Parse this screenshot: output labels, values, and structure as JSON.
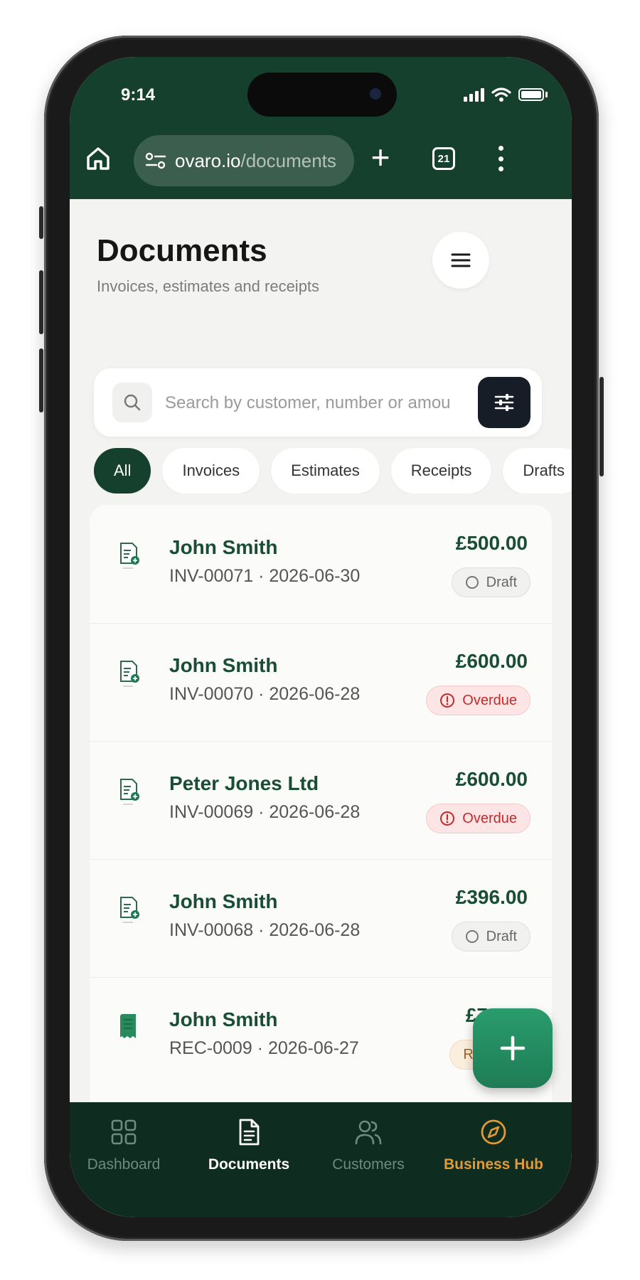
{
  "status_bar": {
    "time": "9:14"
  },
  "browser": {
    "url_host": "ovaro.io",
    "url_path": "/documents",
    "tab_count": "21"
  },
  "page": {
    "title": "Documents",
    "subtitle": "Invoices, estimates and receipts"
  },
  "search": {
    "placeholder": "Search by customer, number or amount",
    "value": ""
  },
  "filters": [
    {
      "label": "All",
      "active": true
    },
    {
      "label": "Invoices",
      "active": false
    },
    {
      "label": "Estimates",
      "active": false
    },
    {
      "label": "Receipts",
      "active": false
    },
    {
      "label": "Drafts",
      "active": false
    }
  ],
  "documents": [
    {
      "name": "John Smith",
      "meta": "INV-00071 · 2026-06-30",
      "amount": "£500.00",
      "status": "Draft",
      "status_type": "draft",
      "doc_type": "invoice"
    },
    {
      "name": "John Smith",
      "meta": "INV-00070 · 2026-06-28",
      "amount": "£600.00",
      "status": "Overdue",
      "status_type": "overdue",
      "doc_type": "invoice"
    },
    {
      "name": "Peter Jones Ltd",
      "meta": "INV-00069 · 2026-06-28",
      "amount": "£600.00",
      "status": "Overdue",
      "status_type": "overdue",
      "doc_type": "invoice"
    },
    {
      "name": "John Smith",
      "meta": "INV-00068 · 2026-06-28",
      "amount": "£396.00",
      "status": "Draft",
      "status_type": "draft",
      "doc_type": "invoice"
    },
    {
      "name": "John Smith",
      "meta": "REC-0009 · 2026-06-27",
      "amount": "£7",
      "status": "Re",
      "status_type": "received",
      "doc_type": "receipt"
    }
  ],
  "bottom_nav": [
    {
      "label": "Dashboard",
      "icon": "grid-icon",
      "state": "dim"
    },
    {
      "label": "Documents",
      "icon": "document-icon",
      "state": "active"
    },
    {
      "label": "Customers",
      "icon": "users-icon",
      "state": "dim"
    },
    {
      "label": "Business Hub",
      "icon": "compass-icon",
      "state": "hub"
    }
  ],
  "colors": {
    "brand_dark": "#16402e",
    "nav_bg": "#0f2c20",
    "fab": "#1e7c55",
    "overdue": "#c42b2b",
    "hub": "#e39a34"
  }
}
